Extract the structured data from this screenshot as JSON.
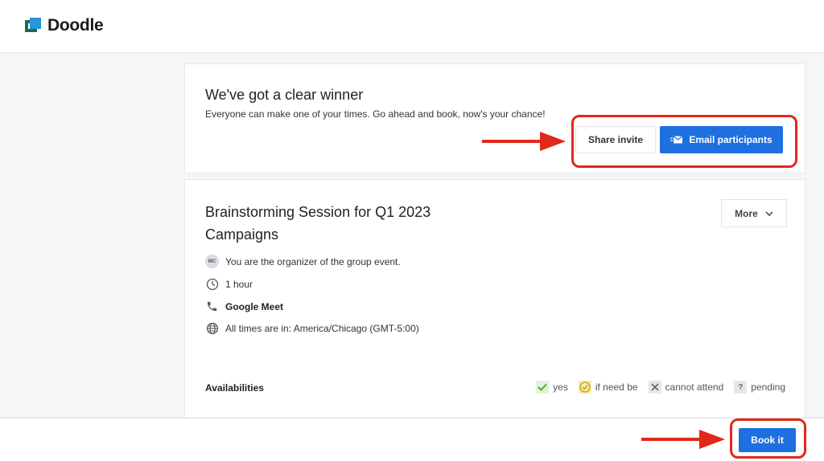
{
  "app": {
    "logo_text": "Doodle"
  },
  "winner": {
    "title": "We've got a clear winner",
    "subtitle": "Everyone can make one of your times. Go ahead and book, now's your chance!",
    "share_label": "Share invite",
    "email_label": "Email participants"
  },
  "event": {
    "title": "Brainstorming Session for Q1 2023 Campaigns",
    "more_label": "More",
    "organizer_initials": "MC",
    "organizer_text": "You are the organizer of the group event.",
    "duration": "1 hour",
    "location": "Google Meet",
    "timezone": "All times are in: America/Chicago (GMT-5:00)"
  },
  "availabilities": {
    "label": "Availabilities",
    "legend": {
      "yes": "yes",
      "if_need_be": "if need be",
      "cannot_attend": "cannot attend",
      "pending": "pending",
      "pending_symbol": "?"
    }
  },
  "footer": {
    "book_label": "Book it"
  },
  "colors": {
    "primary": "#1e6fe0",
    "annotation": "#e0281b",
    "yes": "#4caf2a",
    "if_need_be": "#e8b800"
  },
  "icons": [
    "mail-icon",
    "chevron-down-icon",
    "clock-icon",
    "phone-icon",
    "globe-icon",
    "check-icon",
    "check-circle-icon",
    "x-icon",
    "question-icon"
  ]
}
